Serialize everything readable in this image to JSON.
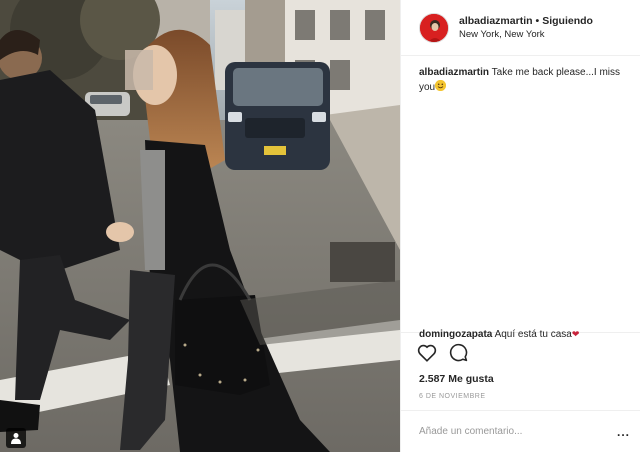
{
  "post": {
    "author": {
      "username": "albadiazmartin",
      "separator": "•",
      "follow_status": "Siguiendo",
      "location": "New York, New York",
      "avatar_color": "#d82020"
    },
    "caption": {
      "username": "albadiazmartin",
      "text": "Take me back please...I miss you",
      "emoji": "smiling-face"
    },
    "comments": [
      {
        "username": "domingozapata",
        "text": "Aquí está tu casa",
        "emoji": "red-heart"
      }
    ],
    "actions": {
      "like_icon": "heart-outline-icon",
      "comment_icon": "speech-bubble-icon"
    },
    "likes_text": "2.587 Me gusta",
    "date_text": "6 DE NOVIEMBRE",
    "add_comment": {
      "placeholder": "Añade un comentario...",
      "more_label": "..."
    },
    "photo": {
      "tagged_icon": "person-tag-icon"
    },
    "colors": {
      "border": "#efefef",
      "text": "#262626",
      "muted": "#999999",
      "heart": "#c8233b"
    }
  }
}
